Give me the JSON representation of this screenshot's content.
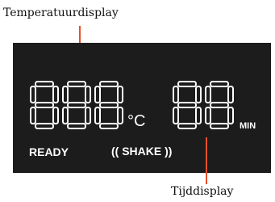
{
  "callouts": {
    "temperature": "Temperatuurdisplay",
    "time": "Tijddisplay"
  },
  "display": {
    "temperature_digits": "888",
    "temperature_unit": "°C",
    "time_digits": "88",
    "time_unit": "MIN",
    "status_ready": "READY",
    "status_shake": "(( SHAKE ))"
  },
  "colors": {
    "panel": "#1c1c1c",
    "segments": "#ffffff",
    "leader_lines": "#e8502a"
  }
}
